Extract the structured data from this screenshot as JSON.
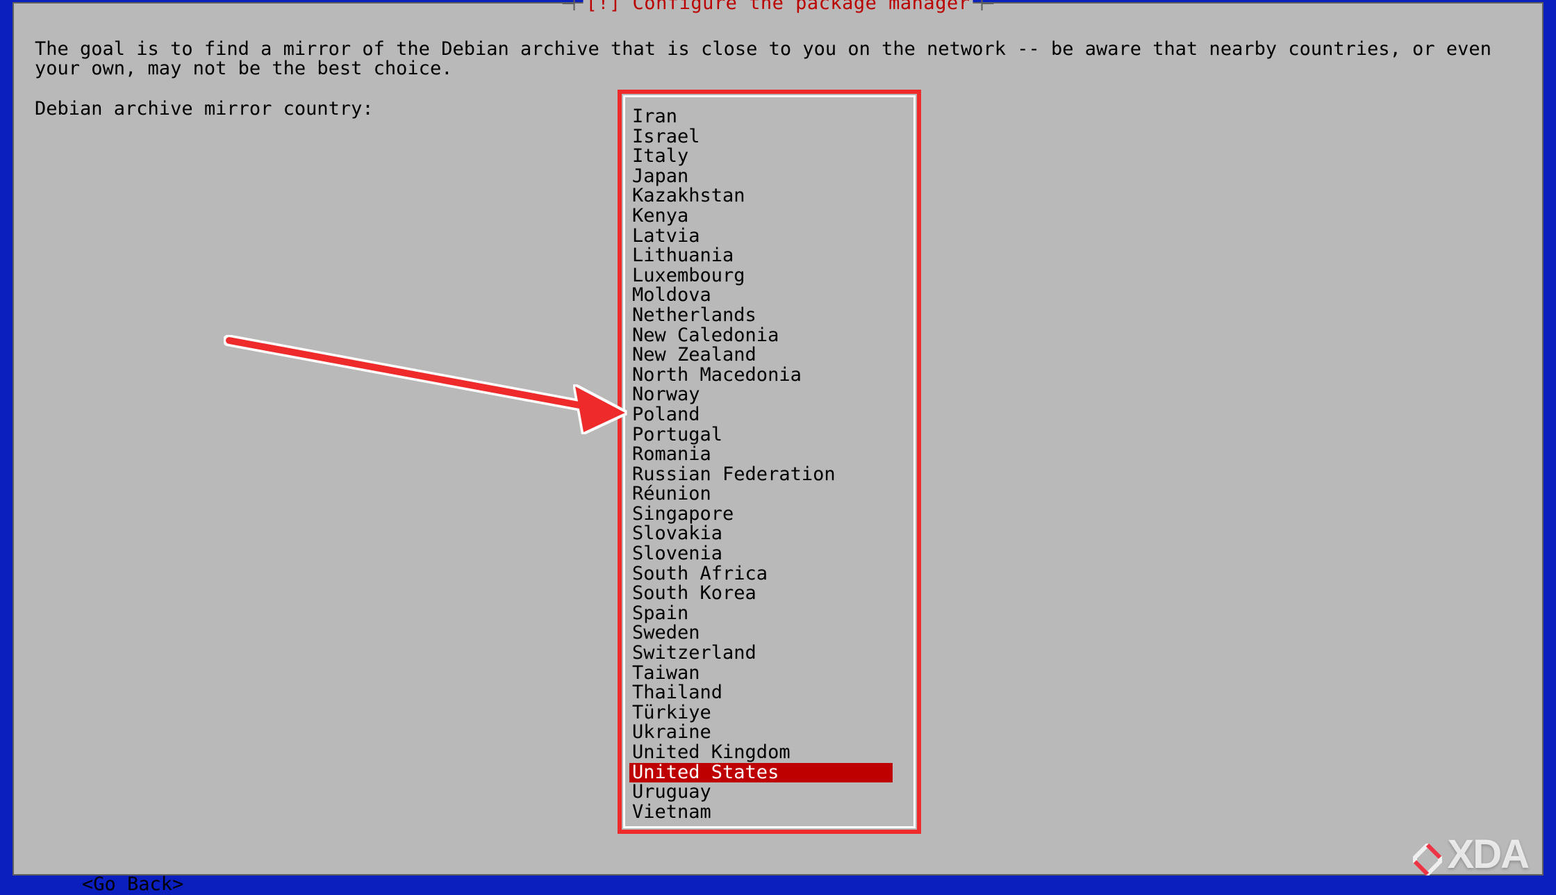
{
  "dialog": {
    "title": "[!] Configure the package manager",
    "description": "The goal is to find a mirror of the Debian archive that is close to you on the network -- be aware that nearby countries, or even your own, may not be the best choice.",
    "prompt": "Debian archive mirror country:",
    "go_back_label": "<Go Back>"
  },
  "list": {
    "selected_index": 33,
    "items": [
      "Iran",
      "Israel",
      "Italy",
      "Japan",
      "Kazakhstan",
      "Kenya",
      "Latvia",
      "Lithuania",
      "Luxembourg",
      "Moldova",
      "Netherlands",
      "New Caledonia",
      "New Zealand",
      "North Macedonia",
      "Norway",
      "Poland",
      "Portugal",
      "Romania",
      "Russian Federation",
      "Réunion",
      "Singapore",
      "Slovakia",
      "Slovenia",
      "South Africa",
      "South Korea",
      "Spain",
      "Sweden",
      "Switzerland",
      "Taiwan",
      "Thailand",
      "Türkiye",
      "Ukraine",
      "United Kingdom",
      "United States",
      "Uruguay",
      "Vietnam"
    ]
  },
  "annotation": {
    "watermark_text": "XDA"
  }
}
